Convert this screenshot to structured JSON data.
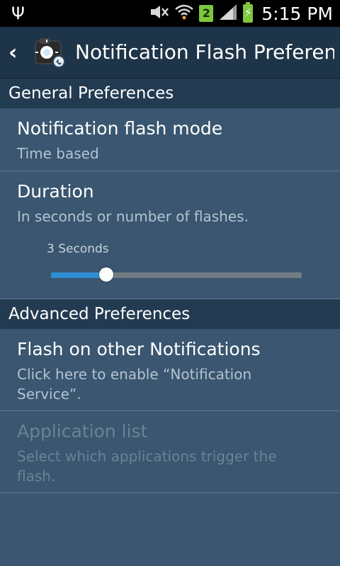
{
  "status_bar": {
    "time": "5:15 PM",
    "sim_slot": "2",
    "icons": [
      "usb-icon",
      "mute-icon",
      "wifi-icon",
      "sim-badge-icon",
      "signal-icon",
      "battery-charging-icon"
    ]
  },
  "action_bar": {
    "title": "Notification Flash Preferen..",
    "back_icon": "chevron-left-icon",
    "app_icon": "camera-flash-app-icon"
  },
  "sections": {
    "general": {
      "header": "General Preferences",
      "flash_mode": {
        "title": "Notification flash mode",
        "summary": "Time based"
      },
      "duration": {
        "title": "Duration",
        "summary": "In seconds or number of flashes.",
        "slider_value_label": "3 Seconds",
        "slider_fraction": 0.22
      }
    },
    "advanced": {
      "header": "Advanced Preferences",
      "other_notifications": {
        "title": "Flash on other Notifications",
        "summary": "Click here to enable “Notification Service”."
      },
      "application_list": {
        "title": "Application list",
        "summary": "Select which applications trigger the flash.",
        "enabled": false
      }
    }
  },
  "colors": {
    "background": "#3a5670",
    "action_bar": "#1e3448",
    "section_header": "#233b51",
    "slider_accent": "#2f8ed4",
    "status_green": "#7ec63e"
  }
}
